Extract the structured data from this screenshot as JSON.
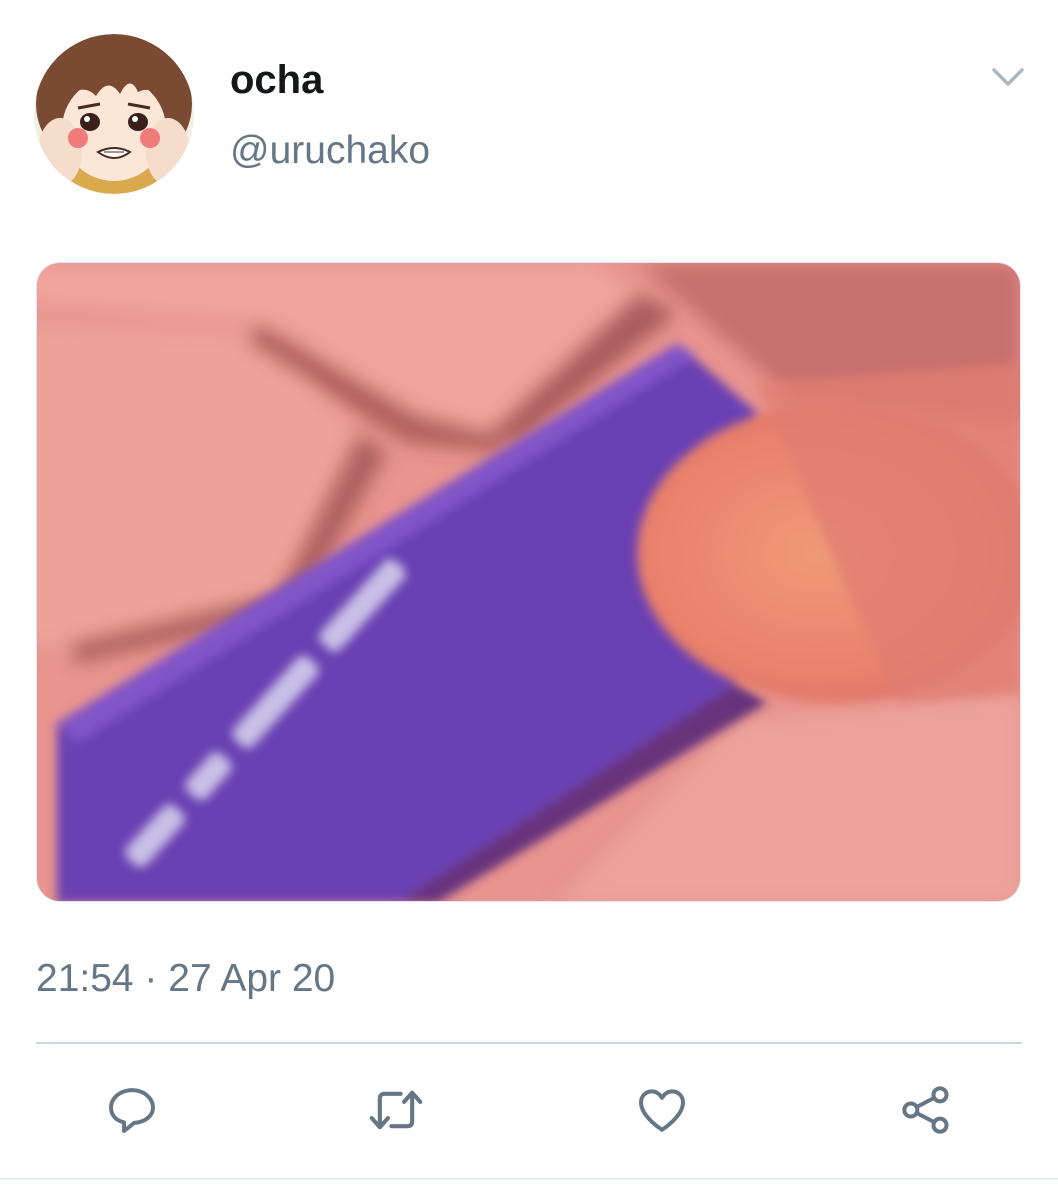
{
  "tweet": {
    "author": {
      "display_name": "ocha",
      "handle": "@uruchako"
    },
    "timestamp": "21:54 · 27 Apr 20",
    "icons": {
      "menu": "chevron-down-icon",
      "reply": "reply-icon",
      "retweet": "retweet-icon",
      "like": "heart-icon",
      "share": "share-icon"
    },
    "colors": {
      "icon_gray": "#657786",
      "name_text": "#14171a",
      "secondary_text": "#657786",
      "divider": "#ccd6dd"
    }
  }
}
